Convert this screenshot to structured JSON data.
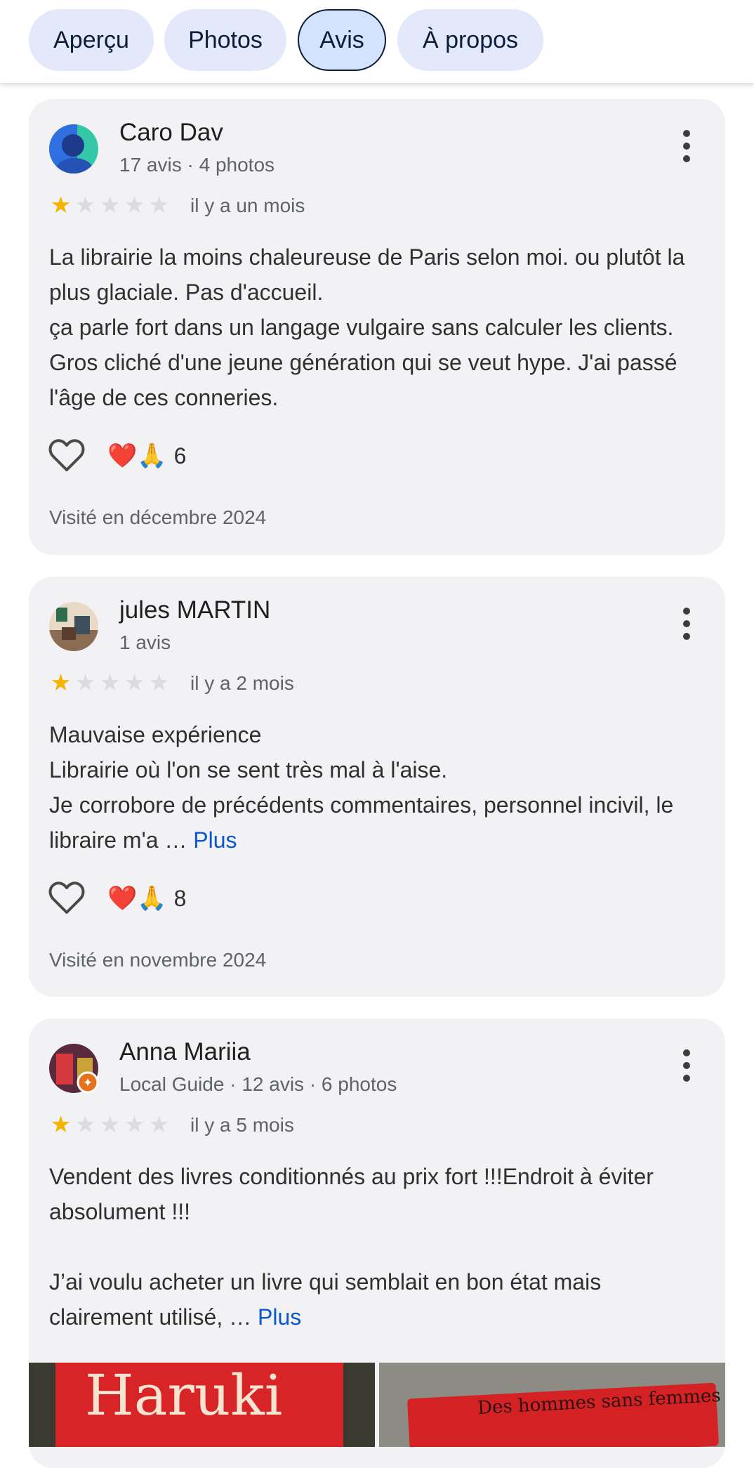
{
  "tabs": [
    {
      "label": "Aperçu",
      "active": false
    },
    {
      "label": "Photos",
      "active": false
    },
    {
      "label": "Avis",
      "active": true
    },
    {
      "label": "À propos",
      "active": false
    }
  ],
  "reviews": [
    {
      "author": "Caro Dav",
      "meta": "17 avis · 4 photos",
      "rating": 1,
      "max_rating": 5,
      "when": "il y a un mois",
      "text_lines": [
        "La librairie la moins chaleureuse de Paris selon moi. ou plutôt la plus glaciale. Pas d'accueil.",
        "ça parle fort dans un langage vulgaire sans calculer les clients. Gros cliché d'une jeune génération qui se veut hype. J'ai passé l'âge de ces conneries."
      ],
      "reactions_emoji": "❤️🙏",
      "reactions_count": "6",
      "visited": "Visité en décembre 2024"
    },
    {
      "author": "jules MARTIN",
      "meta": "1 avis",
      "rating": 1,
      "max_rating": 5,
      "when": "il y a 2 mois",
      "text_lines": [
        "Mauvaise expérience",
        "Librairie où l'on se sent très mal à l'aise.",
        "Je corrobore de précédents commentaires, personnel incivil, le libraire m'a …"
      ],
      "more_label": "Plus",
      "reactions_emoji": "❤️🙏",
      "reactions_count": "8",
      "visited": "Visité en novembre 2024"
    },
    {
      "author": "Anna Mariia",
      "meta": "Local Guide · 12 avis · 6 photos",
      "rating": 1,
      "max_rating": 5,
      "when": "il y a 5 mois",
      "text_lines": [
        "Vendent des livres conditionnés au prix fort !!!Endroit à éviter absolument !!!",
        "J’ai voulu acheter un livre qui semblait en bon état mais clairement utilisé, …"
      ],
      "more_label": "Plus",
      "photo_texts": [
        "Haruki",
        "Des hommes sans femmes"
      ]
    }
  ],
  "colors": {
    "card_bg": "#f2f2f5",
    "star_on": "#f4b400",
    "star_off": "#dadce0",
    "link": "#0b57d0",
    "tab_bg": "#e3e9fb",
    "tab_active_bg": "#d3e3fd"
  },
  "icons": {
    "star": "★",
    "heart": "heart-outline-icon",
    "more": "more-vert-icon",
    "local_guide_badge": "local-guide-badge-icon"
  }
}
